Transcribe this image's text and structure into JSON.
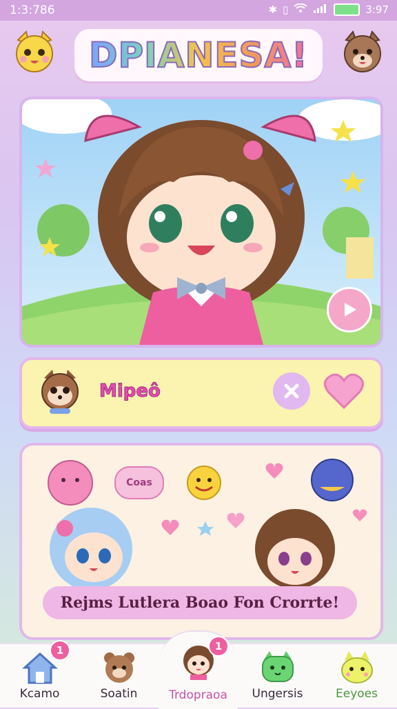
{
  "status_bar": {
    "time": "1:3:786",
    "battery": "3:97"
  },
  "header": {
    "logo": "DPIANESA!"
  },
  "scene": {
    "play_label": "play"
  },
  "match": {
    "name": "Mipeô"
  },
  "chat": {
    "bubble": "Coas",
    "banner": "Rejms Lutlera Boao Fon Crorrte!"
  },
  "nav": {
    "items": [
      {
        "label": "Kcamo",
        "badge": "1",
        "icon": "home-icon"
      },
      {
        "label": "Soatin",
        "icon": "bear-icon"
      },
      {
        "label": "Trdopraoa",
        "badge": "1",
        "icon": "girl-avatar-icon",
        "active": true
      },
      {
        "label": "Ungersis",
        "icon": "green-cat-icon"
      },
      {
        "label": "Eeyoes",
        "icon": "yellow-cat-icon"
      }
    ]
  },
  "colors": {
    "accent": "#ee5fa0",
    "nav_active": "#c74fa6",
    "panel_border": "#e1b7ea"
  }
}
